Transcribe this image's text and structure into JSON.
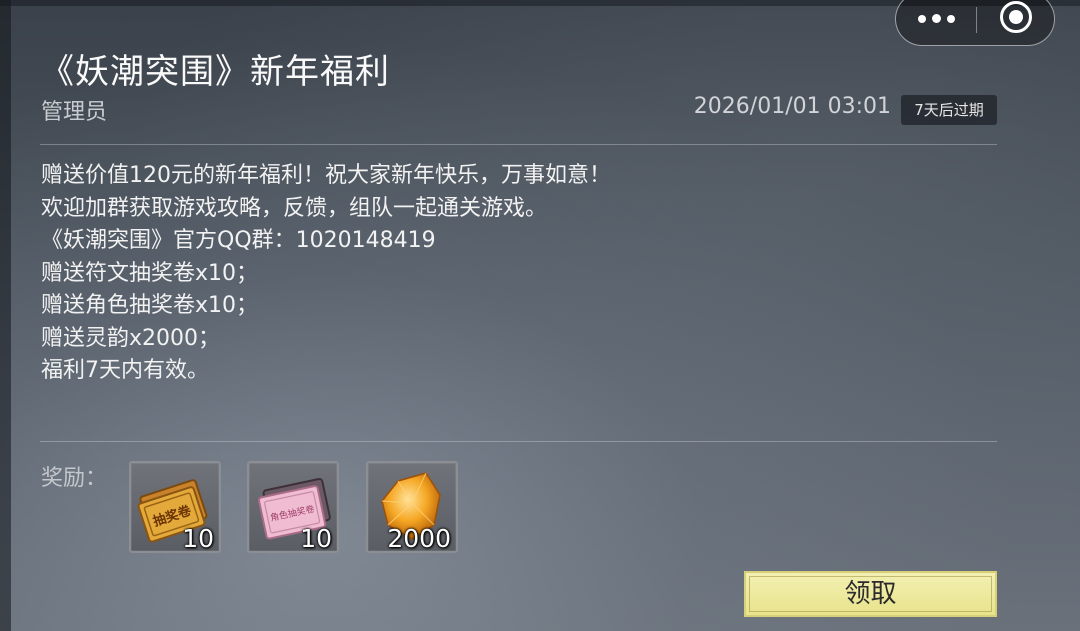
{
  "mail": {
    "title": "《妖潮突围》新年福利",
    "sender": "管理员",
    "date": "2026/01/01 03:01",
    "expire_badge": "7天后过期",
    "body_lines": [
      "赠送价值120元的新年福利！祝大家新年快乐，万事如意！",
      "欢迎加群获取游戏攻略，反馈，组队一起通关游戏。",
      "《妖潮突围》官方QQ群：1020148419",
      "赠送符文抽奖卷x10；",
      "赠送角色抽奖卷x10；",
      "赠送灵韵x2000；",
      "福利7天内有效。"
    ]
  },
  "rewards": {
    "label": "奖励：",
    "items": [
      {
        "icon": "rune-lottery-ticket-icon",
        "ticket_text": "抽奖卷",
        "count": "10"
      },
      {
        "icon": "character-lottery-ticket-icon",
        "ticket_text": "角色抽奖卷",
        "count": "10"
      },
      {
        "icon": "spirit-crystal-icon",
        "count": "2000"
      }
    ]
  },
  "actions": {
    "claim_label": "领取"
  },
  "capsule": {
    "more_icon": "more-dots-icon",
    "close_icon": "close-target-icon"
  },
  "colors": {
    "claim_button": "#ede897",
    "background": "#4a525c"
  }
}
